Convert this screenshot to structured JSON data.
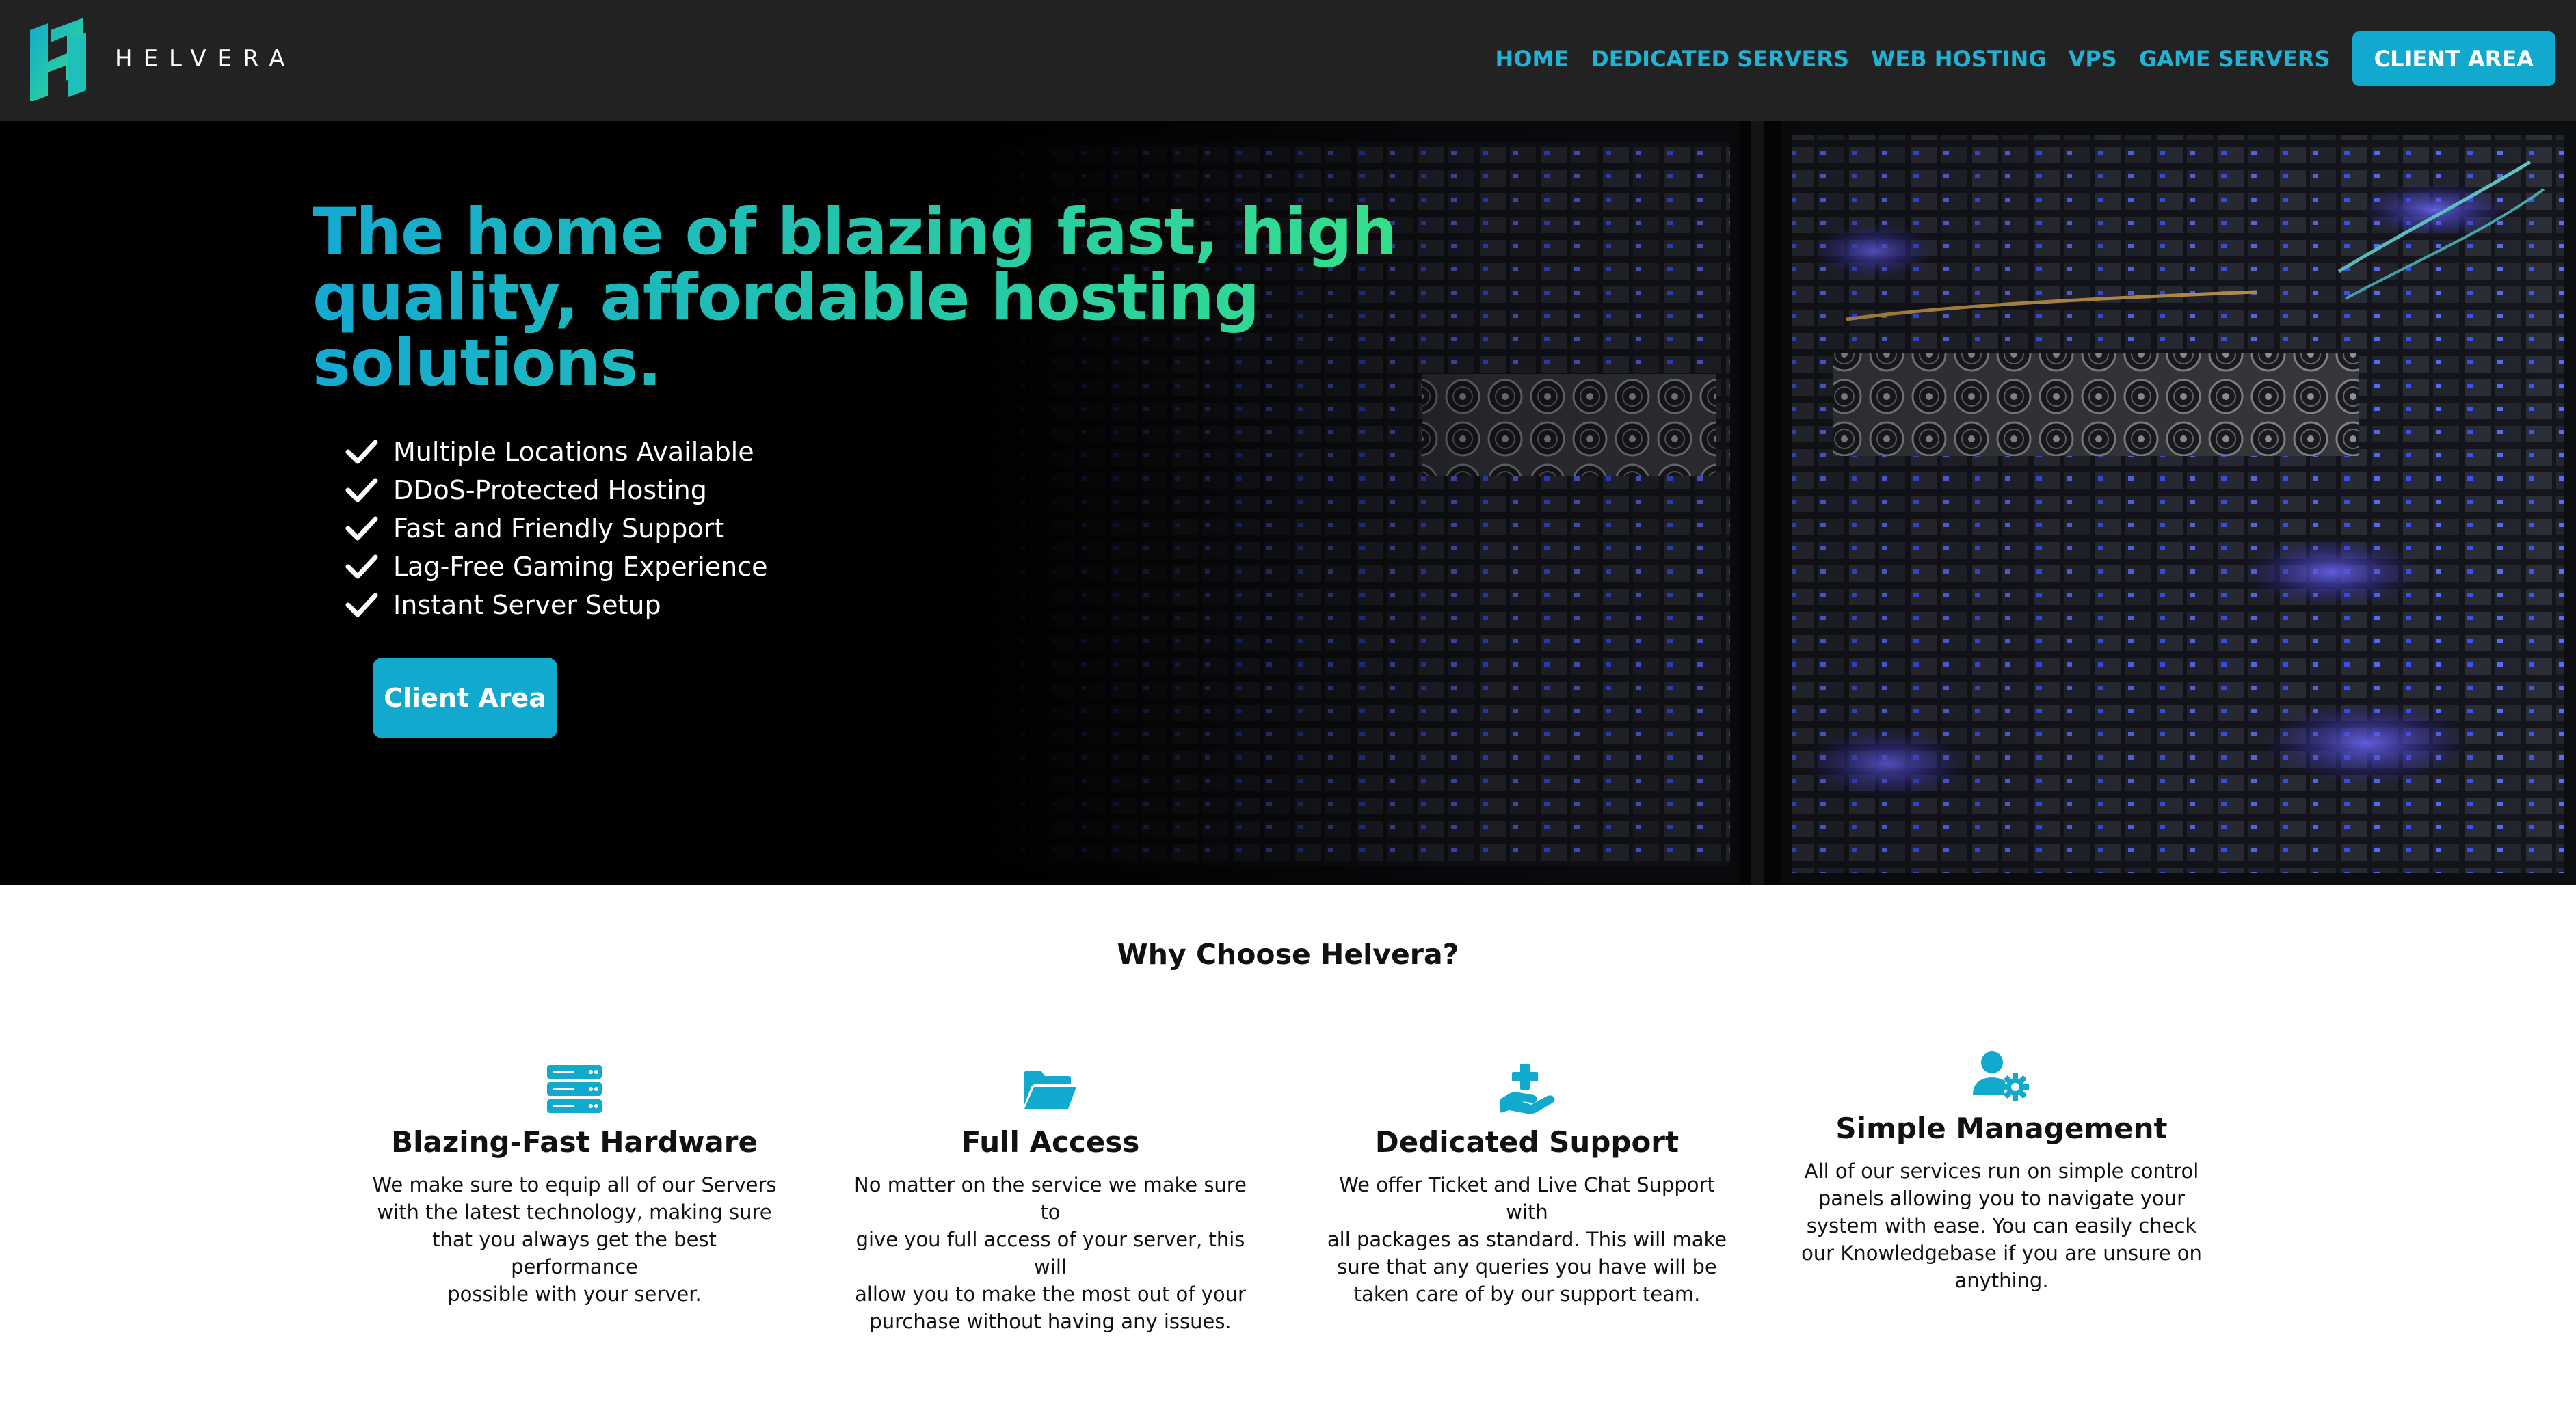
{
  "brand": {
    "name": "HELVERA",
    "logo_icon": "helvera-logo-icon"
  },
  "nav": {
    "links": [
      "HOME",
      "DEDICATED SERVERS",
      "WEB HOSTING",
      "VPS",
      "GAME SERVERS"
    ],
    "cta": "CLIENT AREA"
  },
  "hero": {
    "title_lines": [
      "The home of blazing fast, high",
      "quality, affordable hosting",
      "solutions."
    ],
    "features": [
      "Multiple Locations Available",
      "DDoS-Protected Hosting",
      "Fast and Friendly Support",
      "Lag-Free Gaming Experience",
      "Instant Server Setup"
    ],
    "cta": "Client Area",
    "background": "server-rack-photo"
  },
  "why": {
    "title": "Why Choose Helvera?",
    "cards": [
      {
        "icon": "server-stack-icon",
        "title": "Blazing-Fast Hardware",
        "desc_lines": [
          "We make sure to equip all of our Servers",
          "with the latest technology, making sure",
          "that you always get the best performance",
          "possible with your server."
        ]
      },
      {
        "icon": "folder-open-icon",
        "title": "Full Access",
        "desc_lines": [
          "No matter on the service we make sure to",
          "give you full access of your server, this will",
          "allow you to make the most out of your",
          "purchase without having any issues."
        ]
      },
      {
        "icon": "hand-medical-icon",
        "title": "Dedicated Support",
        "desc_lines": [
          "We offer Ticket and Live Chat Support with",
          "all packages as standard. This will make",
          "sure that any queries you have will be",
          "taken care of by our support team."
        ]
      },
      {
        "icon": "user-gear-icon",
        "title": "Simple Management",
        "desc_lines": [
          "All of our services run on simple control",
          "panels allowing you to navigate your",
          "system with ease. You can easily check",
          "our Knowledgebase if you are unsure on",
          "anything."
        ]
      }
    ]
  },
  "colors": {
    "accent": "#12a9cf",
    "nav_link": "#20b3d6",
    "header_bg": "#222222",
    "title_gradient_start": "#14a9d2",
    "title_gradient_end": "#35e08a"
  }
}
